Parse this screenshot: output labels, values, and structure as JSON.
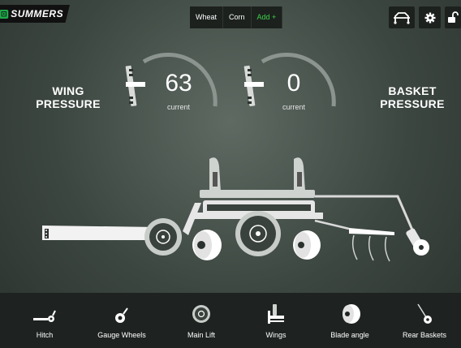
{
  "brand": {
    "name": "SUMMERS"
  },
  "crops": {
    "items": [
      "Wheat",
      "Corn"
    ],
    "add_label": "Add +"
  },
  "header_icons": [
    "hitch-frame-icon",
    "gear-icon",
    "lock-open-icon"
  ],
  "gauges": {
    "wing": {
      "title_line1": "WING",
      "title_line2": "PRESSURE",
      "value": "63",
      "sub": "current"
    },
    "basket": {
      "title_line1": "BASKET",
      "title_line2": "PRESSURE",
      "value": "0",
      "sub": "current"
    }
  },
  "nav": {
    "items": [
      {
        "label": "Hitch",
        "icon": "hitch-icon"
      },
      {
        "label": "Gauge Wheels",
        "icon": "gauge-wheel-icon"
      },
      {
        "label": "Main Lift",
        "icon": "main-lift-icon"
      },
      {
        "label": "Wings",
        "icon": "wings-icon"
      },
      {
        "label": "Blade angle",
        "icon": "blade-icon"
      },
      {
        "label": "Rear Baskets",
        "icon": "basket-icon"
      }
    ]
  },
  "colors": {
    "accent": "#3fd24a",
    "bar": "#1c211e",
    "brand": "#1fa94b"
  }
}
